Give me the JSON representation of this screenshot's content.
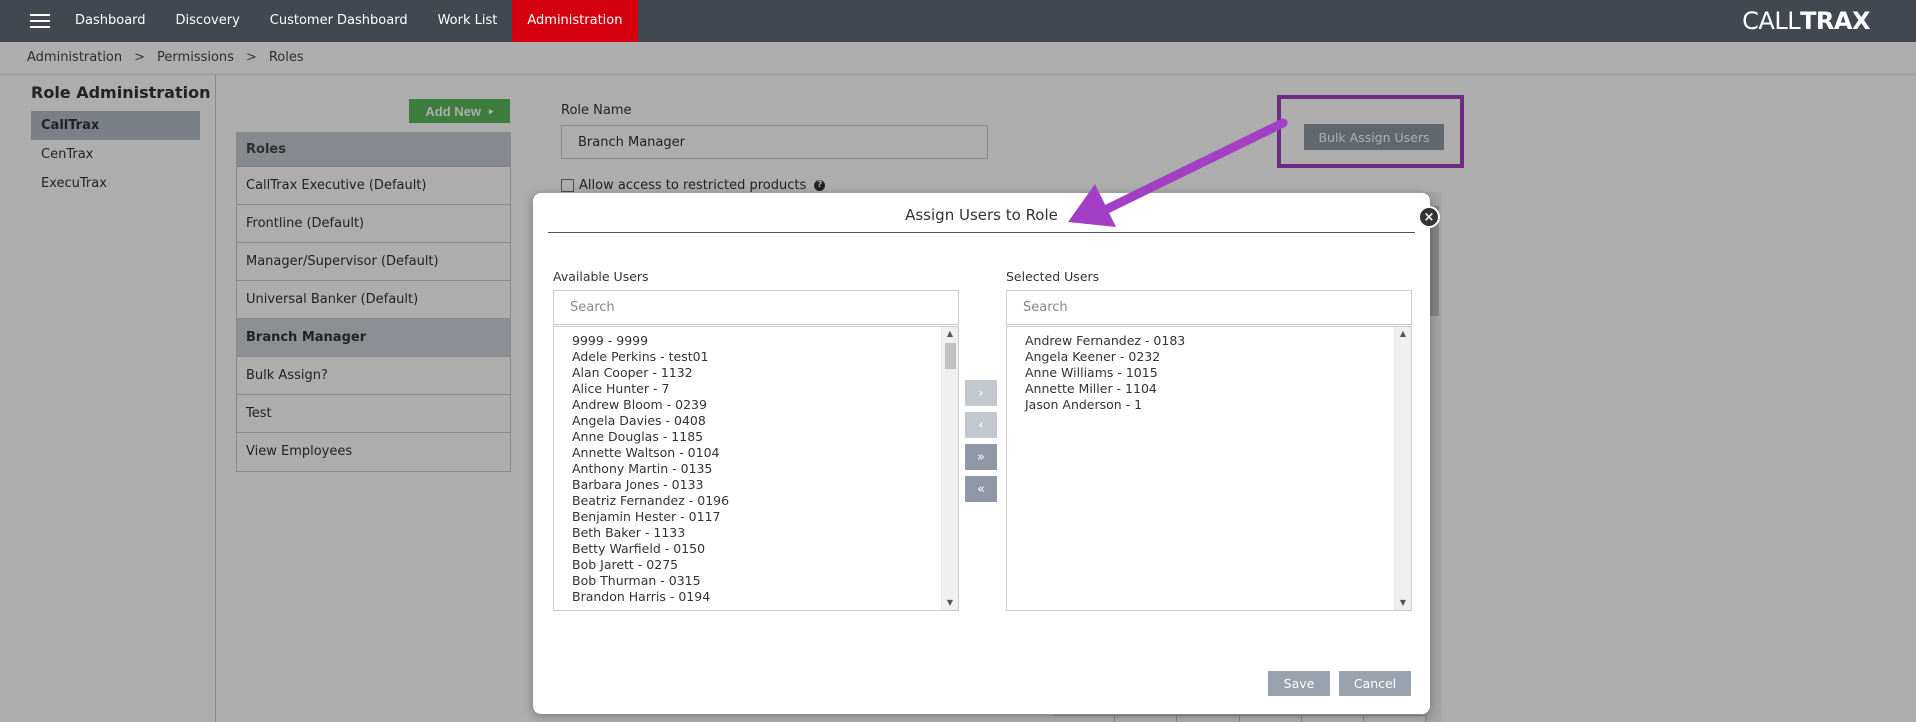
{
  "nav": {
    "items": [
      "Dashboard",
      "Discovery",
      "Customer Dashboard",
      "Work List",
      "Administration"
    ],
    "active": "Administration",
    "brand_light": "CALL",
    "brand_bold": "TRAX"
  },
  "breadcrumb": [
    "Administration",
    "Permissions",
    "Roles"
  ],
  "breadcrumb_sep": ">",
  "left": {
    "title": "Role Administration",
    "products": [
      "CallTrax",
      "CenTrax",
      "ExecuTrax"
    ],
    "active_product": "CallTrax"
  },
  "roles": {
    "add_new_label": "Add New",
    "header": "Roles",
    "items": [
      "CallTrax Executive (Default)",
      "Frontline (Default)",
      "Manager/Supervisor (Default)",
      "Universal Banker (Default)",
      "Branch Manager",
      "Bulk Assign?",
      "Test",
      "View Employees"
    ],
    "active": "Branch Manager"
  },
  "form": {
    "role_name_label": "Role Name",
    "role_name_value": "Branch Manager",
    "restricted_label": "Allow access to restricted products",
    "bulk_assign_label": "Bulk Assign Users"
  },
  "modal": {
    "title": "Assign Users to Role",
    "available_label": "Available Users",
    "selected_label": "Selected Users",
    "search_placeholder": "Search",
    "available_users": [
      "9999 - 9999",
      "Adele Perkins - test01",
      "Alan Cooper - 1132",
      "Alice Hunter - 7",
      "Andrew Bloom - 0239",
      "Angela Davies - 0408",
      "Anne Douglas - 1185",
      "Annette Waltson - 0104",
      "Anthony Martin - 0135",
      "Barbara Jones - 0133",
      "Beatriz Fernandez - 0196",
      "Benjamin Hester - 0117",
      "Beth Baker - 1133",
      "Betty Warfield - 0150",
      "Bob Jarett - 0275",
      "Bob Thurman - 0315",
      "Brandon Harris - 0194"
    ],
    "selected_users": [
      "Andrew Fernandez - 0183",
      "Angela Keener - 0232",
      "Anne Williams - 1015",
      "Annette Miller - 1104",
      "Jason Anderson - 1"
    ],
    "move_buttons": [
      "›",
      "‹",
      "»",
      "«"
    ],
    "save_label": "Save",
    "cancel_label": "Cancel"
  },
  "colors": {
    "nav_bg": "#414850",
    "nav_active": "#d4000f",
    "add_new": "#5cb85c",
    "annotation": "#a23fc4",
    "button_gray": "#9aa2ad"
  }
}
